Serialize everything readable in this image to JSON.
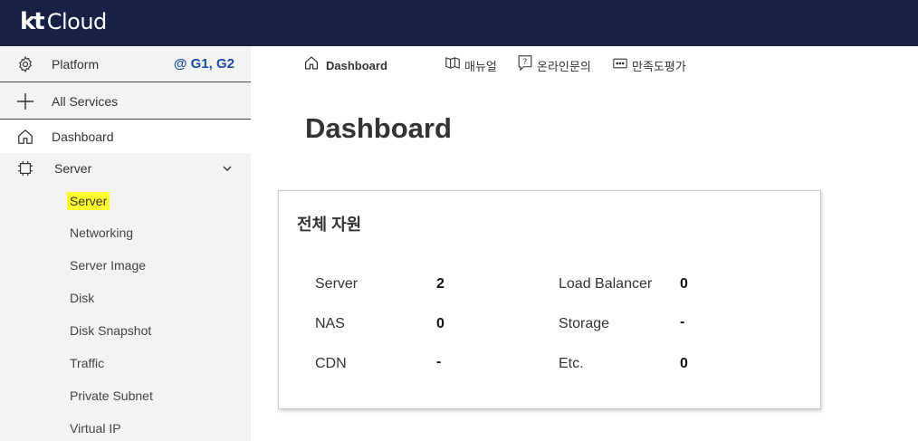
{
  "header": {
    "logo_kt": "kt",
    "logo_cloud": "Cloud"
  },
  "sidebar": {
    "platform_label": "Platform",
    "region": "@ G1, G2",
    "all_services": "All Services",
    "dashboard": "Dashboard",
    "server": "Server",
    "sub_items": [
      "Server",
      "Networking",
      "Server Image",
      "Disk",
      "Disk Snapshot",
      "Traffic",
      "Private Subnet",
      "Virtual IP"
    ]
  },
  "toolbar": {
    "home": "Dashboard",
    "manual": "매뉴얼",
    "inquiry": "온라인문의",
    "survey": "만족도평가"
  },
  "main": {
    "title": "Dashboard",
    "card": {
      "title": "전체 자원",
      "stats": [
        {
          "label": "Server",
          "value": "2"
        },
        {
          "label": "Load Balancer",
          "value": "0"
        },
        {
          "label": "NAS",
          "value": "0"
        },
        {
          "label": "Storage",
          "value": "-"
        },
        {
          "label": "CDN",
          "value": "-"
        },
        {
          "label": "Etc.",
          "value": "0"
        }
      ]
    }
  },
  "colors": {
    "topbar": "#172146",
    "region": "#1a4fa0",
    "highlight": "#ffff2e"
  }
}
